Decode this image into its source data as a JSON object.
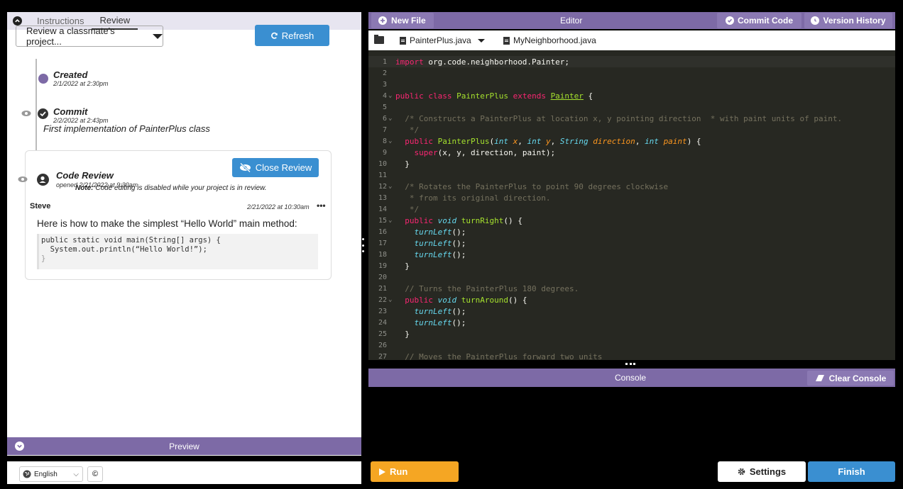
{
  "left_panel": {
    "tabs": [
      "Instructions",
      "Review"
    ],
    "active_tab": "Review",
    "dropdown_label": "Review a classmate's project...",
    "refresh_label": "Refresh",
    "timeline": {
      "created_title": "Created",
      "created_date": "2/1/2022 at 2:30pm",
      "commit_title": "Commit",
      "commit_date": "2/2/2022 at 2:43pm",
      "commit_message": "First implementation of PainterPlus class",
      "review_title": "Code Review",
      "review_date": "opened 2/21/2022 at 9:30am",
      "close_review_label": "Close Review",
      "note_bold": "Note:",
      "note_text": " Code editing is disabled while your project is in review.",
      "comment_author": "Steve",
      "comment_date": "2/21/2022 at 10:30am",
      "comment_menu": "•••",
      "comment_text": "Here is how to make the simplest “Hello World” main method:",
      "comment_code": [
        "public static void main(String[] args) {",
        "  System.out.println(“Hello World!”);",
        "}"
      ]
    },
    "preview_label": "Preview",
    "language": "English",
    "copyright_icon": "©"
  },
  "editor": {
    "new_file_label": "New File",
    "title": "Editor",
    "commit_label": "Commit Code",
    "version_label": "Version History",
    "file_tabs": [
      "PainterPlus.java",
      "MyNeighborhood.java"
    ],
    "active_file": "PainterPlus.java",
    "lines": [
      {
        "n": "1",
        "fold": "",
        "cur": true,
        "t": [
          [
            "kw",
            "import "
          ],
          [
            "code",
            "org.code.neighborhood.Painter;"
          ]
        ]
      },
      {
        "n": "2",
        "fold": "",
        "t": []
      },
      {
        "n": "3",
        "fold": "",
        "t": []
      },
      {
        "n": "4",
        "fold": "⌄",
        "t": [
          [
            "kw",
            "public class "
          ],
          [
            "fn",
            "PainterPlus "
          ],
          [
            "kw",
            "extends "
          ],
          [
            "cl",
            "Painter"
          ],
          [
            "code",
            " {"
          ]
        ]
      },
      {
        "n": "5",
        "fold": "",
        "t": []
      },
      {
        "n": "6",
        "fold": "⌄",
        "t": [
          [
            "cm",
            "  /* Constructs a PainterPlus at location x, y pointing direction  * with paint units of paint."
          ]
        ]
      },
      {
        "n": "7",
        "fold": "",
        "t": [
          [
            "cm",
            "   */"
          ]
        ]
      },
      {
        "n": "8",
        "fold": "⌄",
        "t": [
          [
            "kw",
            "  public "
          ],
          [
            "fn",
            "PainterPlus"
          ],
          [
            "code",
            "("
          ],
          [
            "ty",
            "int "
          ],
          [
            "pr",
            "x"
          ],
          [
            "code",
            ", "
          ],
          [
            "ty",
            "int "
          ],
          [
            "pr",
            "y"
          ],
          [
            "code",
            ", "
          ],
          [
            "ty",
            "String "
          ],
          [
            "pr",
            "direction"
          ],
          [
            "code",
            ", "
          ],
          [
            "ty",
            "int "
          ],
          [
            "pr",
            "paint"
          ],
          [
            "code",
            ") {"
          ]
        ]
      },
      {
        "n": "9",
        "fold": "",
        "t": [
          [
            "kw",
            "    super"
          ],
          [
            "code",
            "(x, y, direction, paint);"
          ]
        ]
      },
      {
        "n": "10",
        "fold": "",
        "t": [
          [
            "code",
            "  }"
          ]
        ]
      },
      {
        "n": "11",
        "fold": "",
        "t": []
      },
      {
        "n": "12",
        "fold": "⌄",
        "t": [
          [
            "cm",
            "  /* Rotates the PainterPlus to point 90 degrees clockwise"
          ]
        ]
      },
      {
        "n": "13",
        "fold": "",
        "t": [
          [
            "cm",
            "   * from its original direction."
          ]
        ]
      },
      {
        "n": "14",
        "fold": "",
        "t": [
          [
            "cm",
            "   */"
          ]
        ]
      },
      {
        "n": "15",
        "fold": "⌄",
        "t": [
          [
            "kw",
            "  public "
          ],
          [
            "ty",
            "void "
          ],
          [
            "fn",
            "turnRight"
          ],
          [
            "code",
            "() {"
          ]
        ]
      },
      {
        "n": "16",
        "fold": "",
        "t": [
          [
            "ty",
            "    turnLeft"
          ],
          [
            "code",
            "();"
          ]
        ]
      },
      {
        "n": "17",
        "fold": "",
        "t": [
          [
            "ty",
            "    turnLeft"
          ],
          [
            "code",
            "();"
          ]
        ]
      },
      {
        "n": "18",
        "fold": "",
        "t": [
          [
            "ty",
            "    turnLeft"
          ],
          [
            "code",
            "();"
          ]
        ]
      },
      {
        "n": "19",
        "fold": "",
        "t": [
          [
            "code",
            "  }"
          ]
        ]
      },
      {
        "n": "20",
        "fold": "",
        "t": []
      },
      {
        "n": "21",
        "fold": "",
        "t": [
          [
            "cm",
            "  // Turns the PainterPlus 180 degrees."
          ]
        ]
      },
      {
        "n": "22",
        "fold": "⌄",
        "t": [
          [
            "kw",
            "  public "
          ],
          [
            "ty",
            "void "
          ],
          [
            "fn",
            "turnAround"
          ],
          [
            "code",
            "() {"
          ]
        ]
      },
      {
        "n": "23",
        "fold": "",
        "t": [
          [
            "ty",
            "    turnLeft"
          ],
          [
            "code",
            "();"
          ]
        ]
      },
      {
        "n": "24",
        "fold": "",
        "t": [
          [
            "ty",
            "    turnLeft"
          ],
          [
            "code",
            "();"
          ]
        ]
      },
      {
        "n": "25",
        "fold": "",
        "t": [
          [
            "code",
            "  }"
          ]
        ]
      },
      {
        "n": "26",
        "fold": "",
        "t": []
      },
      {
        "n": "27",
        "fold": "",
        "t": [
          [
            "cm",
            "  // Moves the PainterPlus forward two units"
          ]
        ]
      }
    ]
  },
  "console": {
    "label": "Console",
    "clear_label": "Clear Console"
  },
  "bottom": {
    "run_label": "Run",
    "settings_label": "Settings",
    "finish_label": "Finish"
  },
  "colors": {
    "accent_purple": "#7d6aa6",
    "button_blue": "#3a8fd1",
    "run_orange": "#f5a623",
    "editor_bg": "#272822"
  }
}
